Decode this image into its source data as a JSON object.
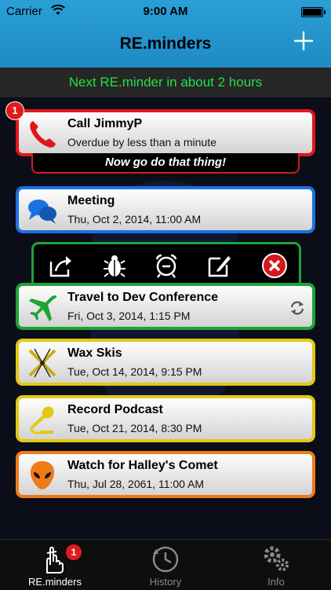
{
  "status_bar": {
    "carrier": "Carrier",
    "time": "9:00 AM"
  },
  "nav": {
    "title": "RE.minders",
    "add_label": "+"
  },
  "banner": {
    "text": "Next RE.minder in about 2 hours"
  },
  "reminders": [
    {
      "title": "Call JimmyP",
      "subtitle": "Overdue by less than a minute",
      "border": "#e3151c",
      "icon": "phone-icon",
      "badge": "1"
    },
    {
      "title": "Meeting",
      "subtitle": "Thu, Oct 2, 2014, 11:00 AM",
      "border": "#1a72e0",
      "icon": "chat-bubbles-icon"
    },
    {
      "title": "Travel to Dev Conference",
      "subtitle": "Fri, Oct 3, 2014, 1:15 PM",
      "border": "#1ea334",
      "icon": "airplane-icon",
      "repeat_icon": "sync-icon"
    },
    {
      "title": "Wax Skis",
      "subtitle": "Tue, Oct 14, 2014, 9:15 PM",
      "border": "#e2c912",
      "icon": "skis-icon"
    },
    {
      "title": "Record Podcast",
      "subtitle": "Tue, Oct 21, 2014, 8:30 PM",
      "border": "#e2c912",
      "icon": "microphone-icon"
    },
    {
      "title": "Watch for Halley's Comet",
      "subtitle": "Thu, Jul 28, 2061, 11:00 AM",
      "border": "#ee7b16",
      "icon": "alien-icon"
    }
  ],
  "overdue_message": "Now go do that thing!",
  "action_bar": [
    "share-icon",
    "bug-icon",
    "alarm-clock-icon",
    "edit-icon",
    "delete-icon"
  ],
  "tabs": [
    {
      "label": "RE.minders",
      "active": true,
      "badge": "1",
      "icon": "finger-string-icon"
    },
    {
      "label": "History",
      "active": false,
      "icon": "history-icon"
    },
    {
      "label": "Info",
      "active": false,
      "icon": "gears-icon"
    }
  ]
}
